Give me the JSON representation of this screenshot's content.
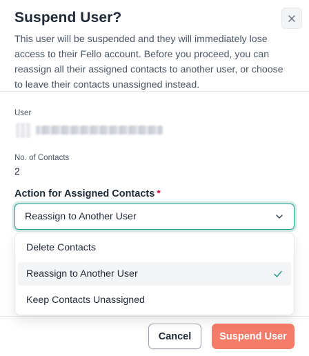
{
  "dialog": {
    "title": "Suspend User?",
    "description": "This user will be suspended and they will immediately lose access to their Fello account. Before you proceed, you can reassign all their assigned contacts to another user, or choose to leave their contacts unassigned instead.",
    "close_icon": "close-icon"
  },
  "user": {
    "label": "User",
    "name_redacted": true
  },
  "contacts": {
    "label": "No. of Contacts",
    "count": "2"
  },
  "action": {
    "label": "Action for Assigned Contacts",
    "required_mark": "*",
    "selected_value": "Reassign to Another User",
    "expanded": true,
    "options": [
      {
        "label": "Delete Contacts",
        "selected": false
      },
      {
        "label": "Reassign to Another User",
        "selected": true
      },
      {
        "label": "Keep Contacts Unassigned",
        "selected": false
      }
    ]
  },
  "footer": {
    "cancel_label": "Cancel",
    "suspend_label": "Suspend User"
  },
  "colors": {
    "accent_teal": "#2a9d8f",
    "danger_button": "#f47c68",
    "required": "#e11d48",
    "check": "#2a9d8f"
  }
}
